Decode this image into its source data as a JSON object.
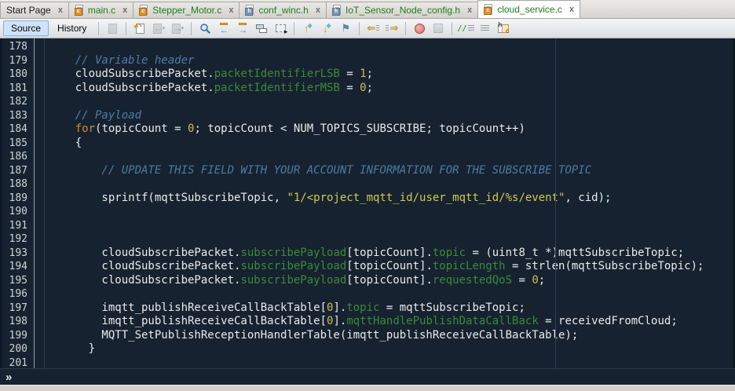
{
  "colors": {
    "editor_bg": "#16222f",
    "text": "#e9ebec",
    "comment": "#4d7ca6",
    "keyword": "#cf8a3c",
    "literal": "#c9c04e",
    "string": "#d2c94f",
    "field": "#3c8a3c",
    "line_number": "#ced4d9",
    "margin_line": "#2c3f52",
    "tab_green": "#1d7c1d",
    "selected_button_bg": "#cfe3f8"
  },
  "tabs": [
    {
      "label": "Start Page",
      "file_type": "none",
      "status": "normal",
      "active": false,
      "close_label": "x"
    },
    {
      "label": "main.c",
      "file_type": "c",
      "status": "vcs-new",
      "active": false,
      "close_label": "x"
    },
    {
      "label": "Stepper_Motor.c",
      "file_type": "c",
      "status": "vcs-new",
      "active": false,
      "close_label": "x"
    },
    {
      "label": "conf_winc.h",
      "file_type": "h",
      "status": "vcs-new",
      "active": false,
      "close_label": "x"
    },
    {
      "label": "IoT_Sensor_Node_config.h",
      "file_type": "h",
      "status": "vcs-new",
      "active": false,
      "close_label": "x"
    },
    {
      "label": "cloud_service.c",
      "file_type": "c",
      "status": "vcs-new",
      "active": true,
      "close_label": "x"
    }
  ],
  "toolbar": {
    "source_label": "Source",
    "history_label": "History",
    "groups": [
      [
        {
          "name": "format-icon",
          "disabled": true
        }
      ],
      [
        {
          "name": "last-edit-icon",
          "disabled": false
        },
        {
          "name": "back-icon",
          "disabled": true
        },
        {
          "name": "forward-icon",
          "disabled": true
        }
      ],
      [
        {
          "name": "find-selection-icon",
          "disabled": false
        },
        {
          "name": "find-previous-icon",
          "disabled": false
        },
        {
          "name": "find-next-icon",
          "disabled": false
        },
        {
          "name": "toggle-highlight-icon",
          "disabled": false
        },
        {
          "name": "rectangular-selection-icon",
          "disabled": false
        }
      ],
      [
        {
          "name": "previous-bookmark-icon",
          "disabled": false
        },
        {
          "name": "next-bookmark-icon",
          "disabled": false
        },
        {
          "name": "toggle-bookmark-icon",
          "disabled": false
        }
      ],
      [
        {
          "name": "shift-left-icon",
          "disabled": false
        },
        {
          "name": "shift-right-icon",
          "disabled": false
        }
      ],
      [
        {
          "name": "start-macro-recording-icon",
          "disabled": false
        },
        {
          "name": "stop-macro-recording-icon",
          "disabled": true
        }
      ],
      [
        {
          "name": "comment-icon",
          "disabled": false
        },
        {
          "name": "uncomment-icon",
          "disabled": false
        },
        {
          "name": "go-to-header-source-icon",
          "disabled": false
        }
      ]
    ]
  },
  "editor": {
    "first_line_number": 178,
    "last_line_number": 201,
    "lines": [
      {
        "n": "178",
        "segs": []
      },
      {
        "n": "179",
        "segs": [
          [
            "com",
            "    // Variable header"
          ]
        ]
      },
      {
        "n": "180",
        "segs": [
          [
            "pln",
            "    cloudSubscribePacket."
          ],
          [
            "fld",
            "packetIdentifierLSB"
          ],
          [
            "pln",
            " = "
          ],
          [
            "num",
            "1"
          ],
          [
            "pln",
            ";"
          ]
        ]
      },
      {
        "n": "181",
        "segs": [
          [
            "pln",
            "    cloudSubscribePacket."
          ],
          [
            "fld",
            "packetIdentifierMSB"
          ],
          [
            "pln",
            " = "
          ],
          [
            "num",
            "0"
          ],
          [
            "pln",
            ";"
          ]
        ]
      },
      {
        "n": "182",
        "segs": []
      },
      {
        "n": "183",
        "segs": [
          [
            "com",
            "    // Payload"
          ]
        ]
      },
      {
        "n": "184",
        "segs": [
          [
            "pln",
            "    "
          ],
          [
            "kw",
            "for"
          ],
          [
            "pln",
            "(topicCount = "
          ],
          [
            "num",
            "0"
          ],
          [
            "pln",
            "; topicCount < NUM_TOPICS_SUBSCRIBE; topicCount++)"
          ]
        ]
      },
      {
        "n": "185",
        "segs": [
          [
            "pln",
            "    {"
          ]
        ]
      },
      {
        "n": "186",
        "segs": []
      },
      {
        "n": "187",
        "segs": [
          [
            "com",
            "        // UPDATE THIS FIELD WITH YOUR ACCOUNT INFORMATION FOR THE SUBSCRIBE TOPIC"
          ]
        ]
      },
      {
        "n": "188",
        "segs": []
      },
      {
        "n": "189",
        "segs": [
          [
            "pln",
            "        sprintf(mqttSubscribeTopic, "
          ],
          [
            "str",
            "\"1/<project_mqtt_id/user_mqtt_id/%s/event\""
          ],
          [
            "pln",
            ", cid);"
          ]
        ]
      },
      {
        "n": "190",
        "segs": []
      },
      {
        "n": "191",
        "segs": []
      },
      {
        "n": "192",
        "segs": []
      },
      {
        "n": "193",
        "segs": [
          [
            "pln",
            "        cloudSubscribePacket."
          ],
          [
            "fld",
            "subscribePayload"
          ],
          [
            "pln",
            "[topicCount]."
          ],
          [
            "fld",
            "topic"
          ],
          [
            "pln",
            " = (uint8_t *)mqttSubscribeTopic;"
          ]
        ]
      },
      {
        "n": "194",
        "segs": [
          [
            "pln",
            "        cloudSubscribePacket."
          ],
          [
            "fld",
            "subscribePayload"
          ],
          [
            "pln",
            "[topicCount]."
          ],
          [
            "fld",
            "topicLength"
          ],
          [
            "pln",
            " = strlen(mqttSubscribeTopic);"
          ]
        ]
      },
      {
        "n": "195",
        "segs": [
          [
            "pln",
            "        cloudSubscribePacket."
          ],
          [
            "fld",
            "subscribePayload"
          ],
          [
            "pln",
            "[topicCount]."
          ],
          [
            "fld",
            "requestedQoS"
          ],
          [
            "pln",
            " = "
          ],
          [
            "num",
            "0"
          ],
          [
            "pln",
            ";"
          ]
        ]
      },
      {
        "n": "196",
        "segs": []
      },
      {
        "n": "197",
        "segs": [
          [
            "pln",
            "        imqtt_publishReceiveCallBackTable["
          ],
          [
            "num",
            "0"
          ],
          [
            "pln",
            "]."
          ],
          [
            "fld",
            "topic"
          ],
          [
            "pln",
            " = mqttSubscribeTopic;"
          ]
        ]
      },
      {
        "n": "198",
        "segs": [
          [
            "pln",
            "        imqtt_publishReceiveCallBackTable["
          ],
          [
            "num",
            "0"
          ],
          [
            "pln",
            "]."
          ],
          [
            "fld",
            "mqttHandlePublishDataCallBack"
          ],
          [
            "pln",
            " = receivedFromCloud;"
          ]
        ]
      },
      {
        "n": "199",
        "segs": [
          [
            "pln",
            "        MQTT_SetPublishReceptionHandlerTable(imqtt_publishReceiveCallBackTable);"
          ]
        ]
      },
      {
        "n": "200",
        "segs": [
          [
            "pln",
            "      }"
          ]
        ]
      },
      {
        "n": "201",
        "segs": []
      }
    ]
  },
  "breadcrumb": {
    "expand_chevron": "»"
  }
}
